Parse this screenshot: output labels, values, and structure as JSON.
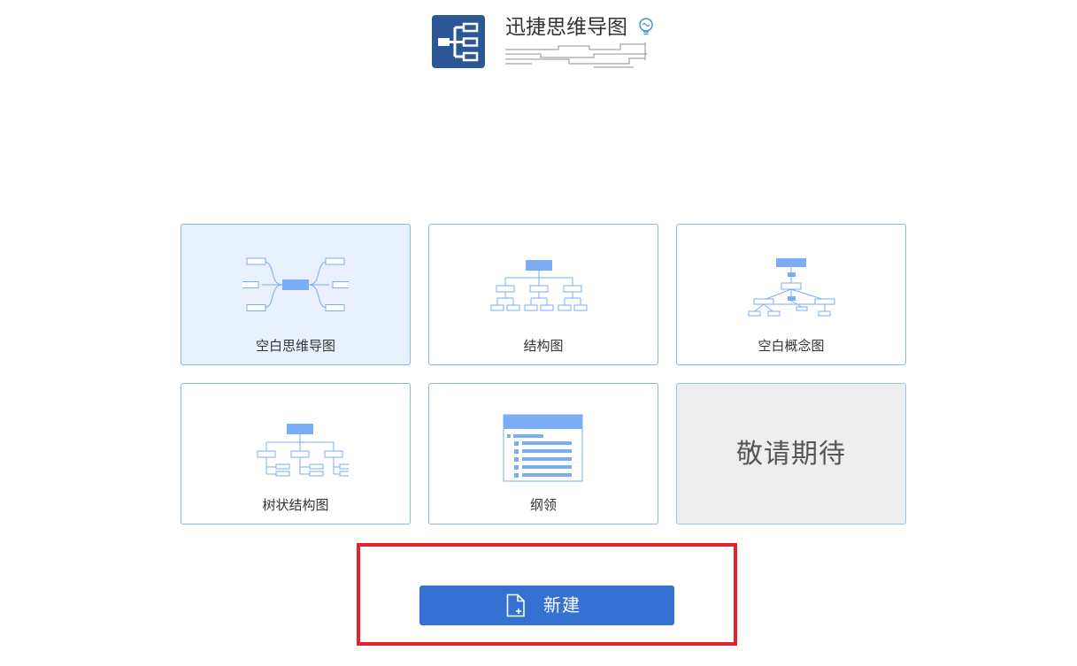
{
  "brand": {
    "title": "迅捷思维导图",
    "logo_icon": "mindmap-logo-icon",
    "bulb_icon": "lightbulb-icon",
    "logo_color": "#2b5797"
  },
  "templates": [
    {
      "label": "空白思维导图",
      "icon": "mindmap-template-icon",
      "selected": true
    },
    {
      "label": "结构图",
      "icon": "org-chart-template-icon"
    },
    {
      "label": "空白概念图",
      "icon": "concept-map-template-icon"
    },
    {
      "label": "树状结构图",
      "icon": "tree-chart-template-icon"
    },
    {
      "label": "纲领",
      "icon": "outline-template-icon"
    },
    {
      "label": "敬请期待",
      "disabled": true
    }
  ],
  "create": {
    "label": "新建",
    "icon": "new-file-icon"
  },
  "colors": {
    "accent": "#3471d3",
    "card_border": "#8fb4e6",
    "selected_bg": "#e8f1fd",
    "illustration": "#7aadf5",
    "highlight_frame": "#e3222b"
  }
}
